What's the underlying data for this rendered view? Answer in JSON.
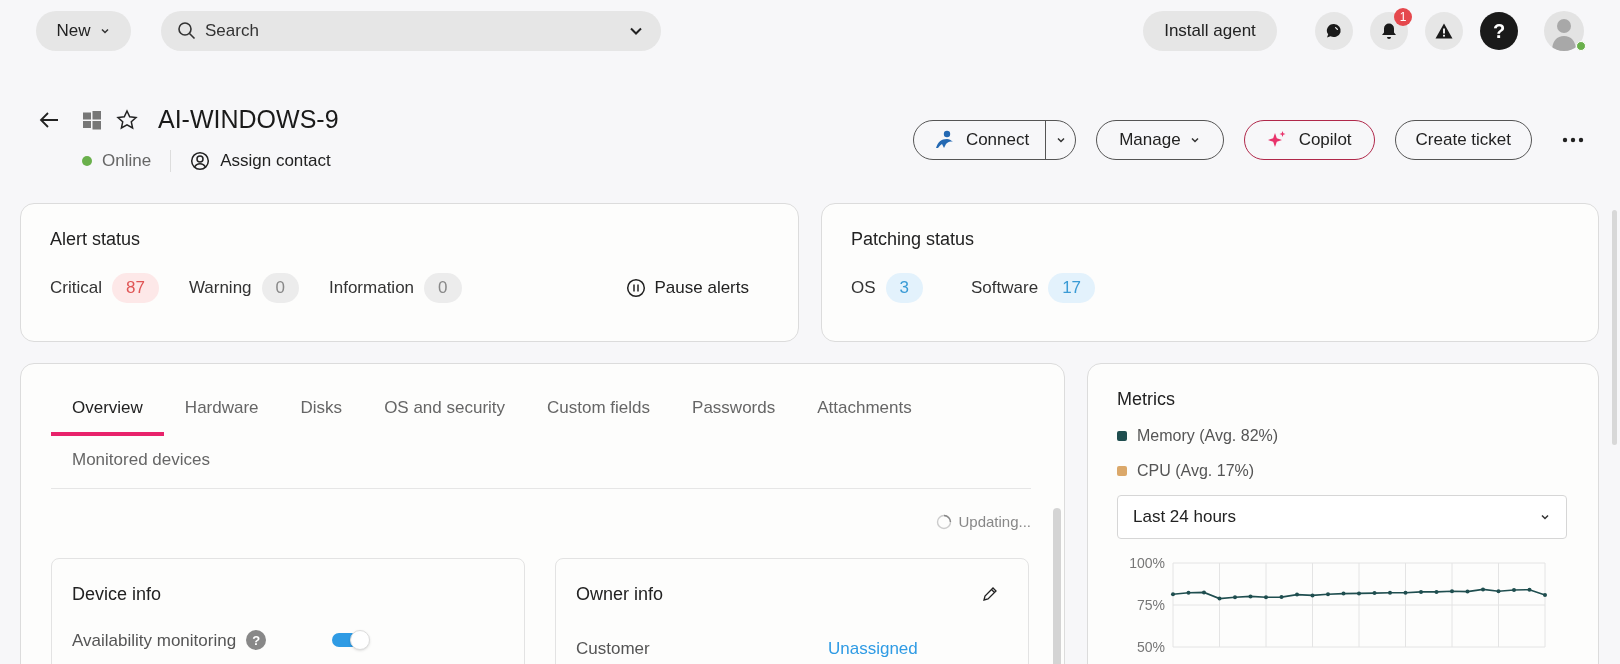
{
  "topbar": {
    "new_button": "New",
    "search": {
      "placeholder": "Search"
    },
    "install_agent": "Install agent",
    "notification_count": "1",
    "help": "?"
  },
  "device": {
    "name": "AI-WINDOWS-9",
    "status": "Online",
    "online": true,
    "assign_contact": "Assign contact"
  },
  "actions": {
    "connect": "Connect",
    "manage": "Manage",
    "copilot": "Copilot",
    "create_ticket": "Create ticket"
  },
  "alert_status": {
    "title": "Alert status",
    "pause": "Pause alerts",
    "counts": [
      {
        "label": "Critical",
        "value": "87",
        "kind": "critical"
      },
      {
        "label": "Warning",
        "value": "0",
        "kind": "neutral"
      },
      {
        "label": "Information",
        "value": "0",
        "kind": "neutral"
      }
    ]
  },
  "patching_status": {
    "title": "Patching status",
    "counts": [
      {
        "label": "OS",
        "value": "3"
      },
      {
        "label": "Software",
        "value": "17"
      }
    ]
  },
  "tabs": [
    {
      "label": "Overview",
      "selected": true
    },
    {
      "label": "Hardware",
      "selected": false
    },
    {
      "label": "Disks",
      "selected": false
    },
    {
      "label": "OS and security",
      "selected": false
    },
    {
      "label": "Custom fields",
      "selected": false
    },
    {
      "label": "Passwords",
      "selected": false
    },
    {
      "label": "Attachments",
      "selected": false
    },
    {
      "label": "Monitored devices",
      "selected": false
    }
  ],
  "updating": "Updating...",
  "device_info": {
    "title": "Device info",
    "rows": [
      {
        "label": "Availability monitoring",
        "help": "?",
        "on": true
      }
    ]
  },
  "owner_info": {
    "title": "Owner info",
    "rows": [
      {
        "label": "Customer",
        "value": "Unassigned"
      }
    ]
  },
  "metrics": {
    "title": "Metrics",
    "range": "Last 24 hours",
    "legend": [
      {
        "label": "CPU (Avg. 17%)",
        "color": "#dba86a"
      }
    ],
    "chart_data": {
      "type": "line",
      "grid": true,
      "ylim": [
        50,
        100
      ],
      "yticks": [
        {
          "value": 100,
          "label": "100%"
        },
        {
          "value": 75,
          "label": "75%"
        },
        {
          "value": 50,
          "label": "50%"
        }
      ],
      "series": [
        {
          "name": "Memory (Avg. 82%)",
          "color": "#1f4e4f",
          "values": [
            81.4,
            82.3,
            82.5,
            78.8,
            79.6,
            80.1,
            79.6,
            79.7,
            81.2,
            80.7,
            81.4,
            81.8,
            81.9,
            82.1,
            82.3,
            82.3,
            82.8,
            82.8,
            83.2,
            83.0,
            84.3,
            83.2,
            83.9,
            84.1,
            81.0
          ]
        }
      ]
    }
  }
}
